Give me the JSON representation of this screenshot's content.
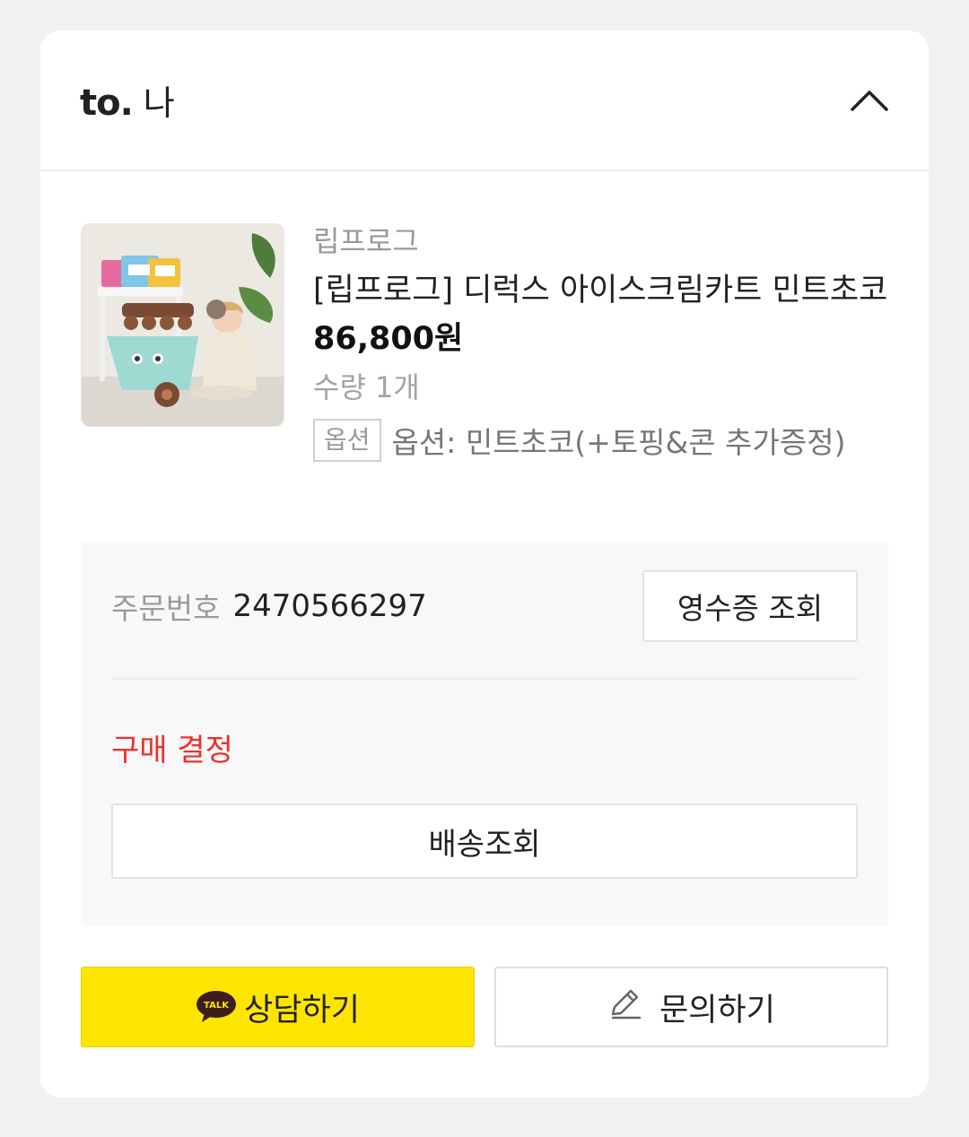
{
  "header": {
    "to_label": "to.",
    "recipient_name": "나",
    "collapse_icon": "chevron-up-icon"
  },
  "product": {
    "brand": "립프로그",
    "title": "[립프로그] 디럭스 아이스크림카트 민트초코",
    "price": "86,800원",
    "quantity": "수량 1개",
    "option_tag": "옵션",
    "option_text": "옵션: 민트초코(+토핑&콘 추가증정)"
  },
  "order": {
    "number_label": "주문번호",
    "number": "2470566297",
    "receipt_button": "영수증 조회",
    "status": "구매 결정",
    "status_color": "#e8322d",
    "shipping_button": "배송조회"
  },
  "actions": {
    "chat_icon_text": "TALK",
    "chat_button": "상담하기",
    "chat_color": "#fee500",
    "ask_icon": "pencil-icon",
    "ask_button": "문의하기"
  }
}
